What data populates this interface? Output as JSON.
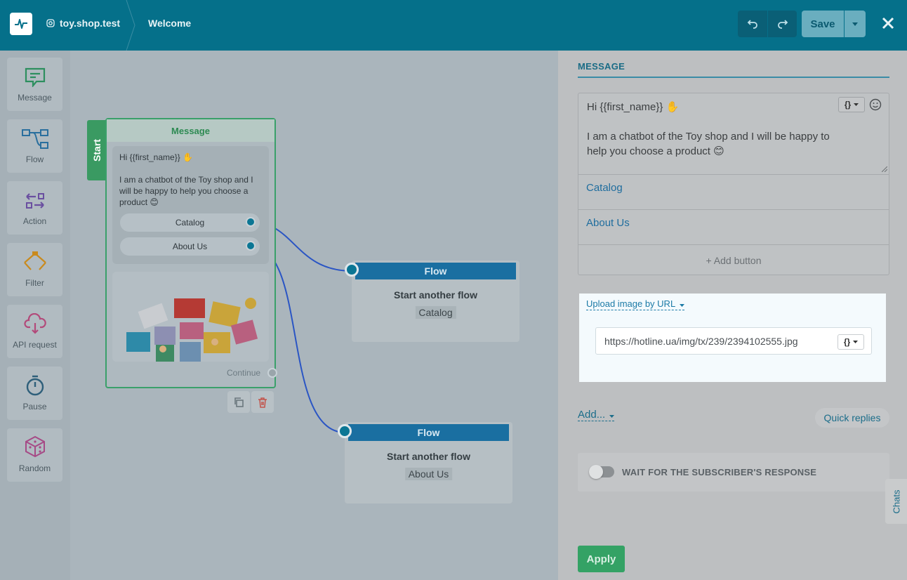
{
  "header": {
    "account": "toy.shop.test",
    "page": "Welcome",
    "save_label": "Save"
  },
  "toolbox": [
    {
      "label": "Message",
      "icon": "message-icon"
    },
    {
      "label": "Flow",
      "icon": "flow-icon"
    },
    {
      "label": "Action",
      "icon": "action-icon"
    },
    {
      "label": "Filter",
      "icon": "filter-icon"
    },
    {
      "label": "API request",
      "icon": "api-request-icon"
    },
    {
      "label": "Pause",
      "icon": "pause-icon"
    },
    {
      "label": "Random",
      "icon": "random-icon"
    }
  ],
  "canvas": {
    "start_label": "Start",
    "message_node": {
      "title": "Message",
      "line1": "Hi {{first_name}} ✋",
      "line2": "I am a chatbot of the Toy shop and I will be happy to help you choose a product 😊",
      "buttons": [
        "Catalog",
        "About Us"
      ],
      "continue_label": "Continue"
    },
    "flow_nodes": [
      {
        "title": "Flow",
        "subtitle": "Start another flow",
        "tag": "Catalog"
      },
      {
        "title": "Flow",
        "subtitle": "Start another flow",
        "tag": "About Us"
      }
    ]
  },
  "panel": {
    "section_title": "MESSAGE",
    "text_line1": "Hi {{first_name}} ✋",
    "text_line2": "I am a chatbot of the Toy shop and I will be happy to help you choose a product 😊",
    "var_label": "{}",
    "buttons": [
      "Catalog",
      "About Us"
    ],
    "add_button": "+ Add button",
    "upload_label": "Upload image by URL",
    "image_url": "https://hotline.ua/img/tx/239/2394102555.jpg",
    "add_label": "Add...",
    "quick_replies": "Quick replies",
    "wait_label": "WAIT FOR THE SUBSCRIBER'S RESPONSE",
    "wait_enabled": false,
    "apply_label": "Apply",
    "chats_label": "Chats"
  }
}
